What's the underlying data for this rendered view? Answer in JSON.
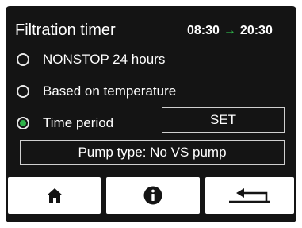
{
  "header": {
    "title": "Filtration timer",
    "start_time": "08:30",
    "arrow_glyph": "→",
    "end_time": "20:30",
    "arrow_color": "#2fb34a"
  },
  "options": [
    {
      "label": "NONSTOP 24 hours",
      "selected": false
    },
    {
      "label": "Based on temperature",
      "selected": false
    },
    {
      "label": "Time period",
      "selected": true
    }
  ],
  "set_button": {
    "label": "SET"
  },
  "pump_type": {
    "text": "Pump type: No VS pump"
  },
  "nav": [
    {
      "icon": "home-icon"
    },
    {
      "icon": "info-icon"
    },
    {
      "icon": "return-icon"
    }
  ],
  "colors": {
    "background": "#141414",
    "accent": "#2fb34a",
    "button": "#ffffff"
  }
}
